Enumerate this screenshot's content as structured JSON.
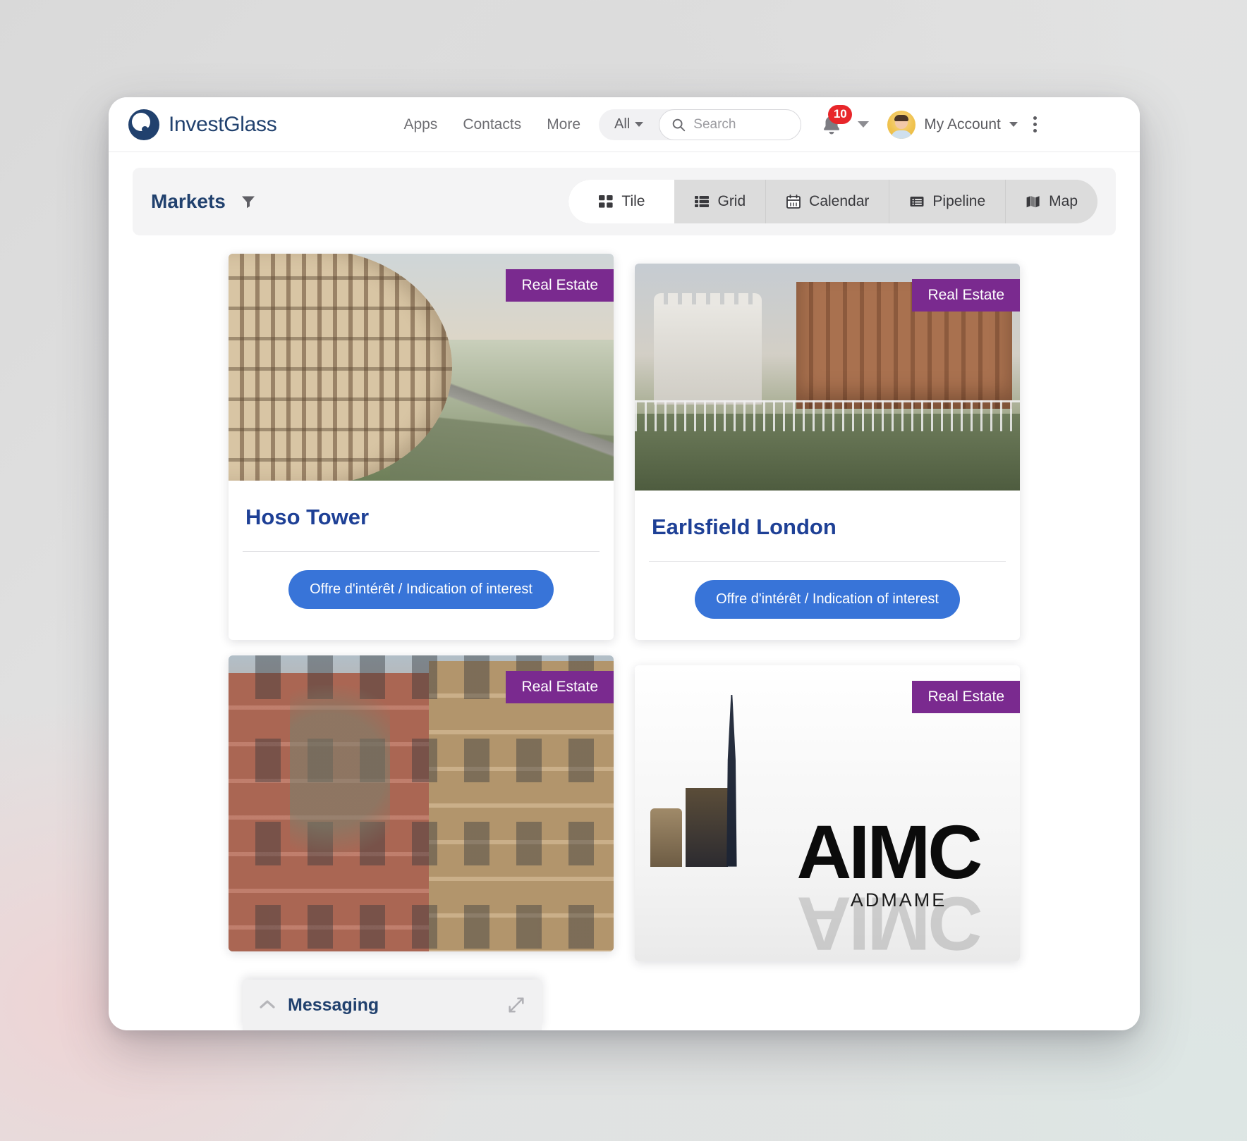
{
  "header": {
    "brand_name": "InvestGlass",
    "brand_logo_icon": "investglass-circle-logo",
    "nav": [
      {
        "label": "Apps"
      },
      {
        "label": "Contacts"
      },
      {
        "label": "More"
      }
    ],
    "search_scope": "All",
    "search_placeholder": "Search",
    "search_value": "",
    "search_icon": "search-icon",
    "notification_icon": "bell-icon",
    "notification_count": "10",
    "notification_badge_color": "#e8262a",
    "account_name": "My Account",
    "avatar_icon": "user-avatar",
    "overflow_icon": "kebab-menu-icon"
  },
  "toolbar": {
    "title": "Markets",
    "filter_icon": "filter-funnel-icon",
    "tabs": [
      {
        "label": "Tile",
        "icon": "tile-grid-icon",
        "active": true
      },
      {
        "label": "Grid",
        "icon": "list-grid-icon",
        "active": false
      },
      {
        "label": "Calendar",
        "icon": "calendar-icon",
        "active": false
      },
      {
        "label": "Pipeline",
        "icon": "pipeline-list-icon",
        "active": false
      },
      {
        "label": "Map",
        "icon": "map-folded-icon",
        "active": false
      }
    ]
  },
  "cards": [
    {
      "title": "Hoso Tower",
      "category": "Real Estate",
      "cta": "Offre d'intérêt / Indication of interest",
      "image_alt": "curved-timber-facade-tower"
    },
    {
      "title": "Earlsfield London",
      "category": "Real Estate",
      "cta": "Offre d'intérêt / Indication of interest",
      "image_alt": "brick-apartment-block-canal"
    },
    {
      "title": "",
      "category": "Real Estate",
      "cta": "",
      "image_alt": "brownstone-apartment-street"
    },
    {
      "title": "",
      "category": "Real Estate",
      "cta": "",
      "image_alt": "aimc-admame-logo-skyline",
      "logo_text": "AIMC",
      "logo_subtext": "ADMAME"
    }
  ],
  "messaging": {
    "title": "Messaging",
    "collapse_icon": "chevron-up-icon",
    "expand_icon": "expand-diagonal-icon"
  },
  "colors": {
    "brand_navy": "#21416e",
    "card_title_blue": "#1e4096",
    "badge_purple": "#7a2a8f",
    "cta_blue": "#3874d8",
    "notification_red": "#e8262a"
  }
}
